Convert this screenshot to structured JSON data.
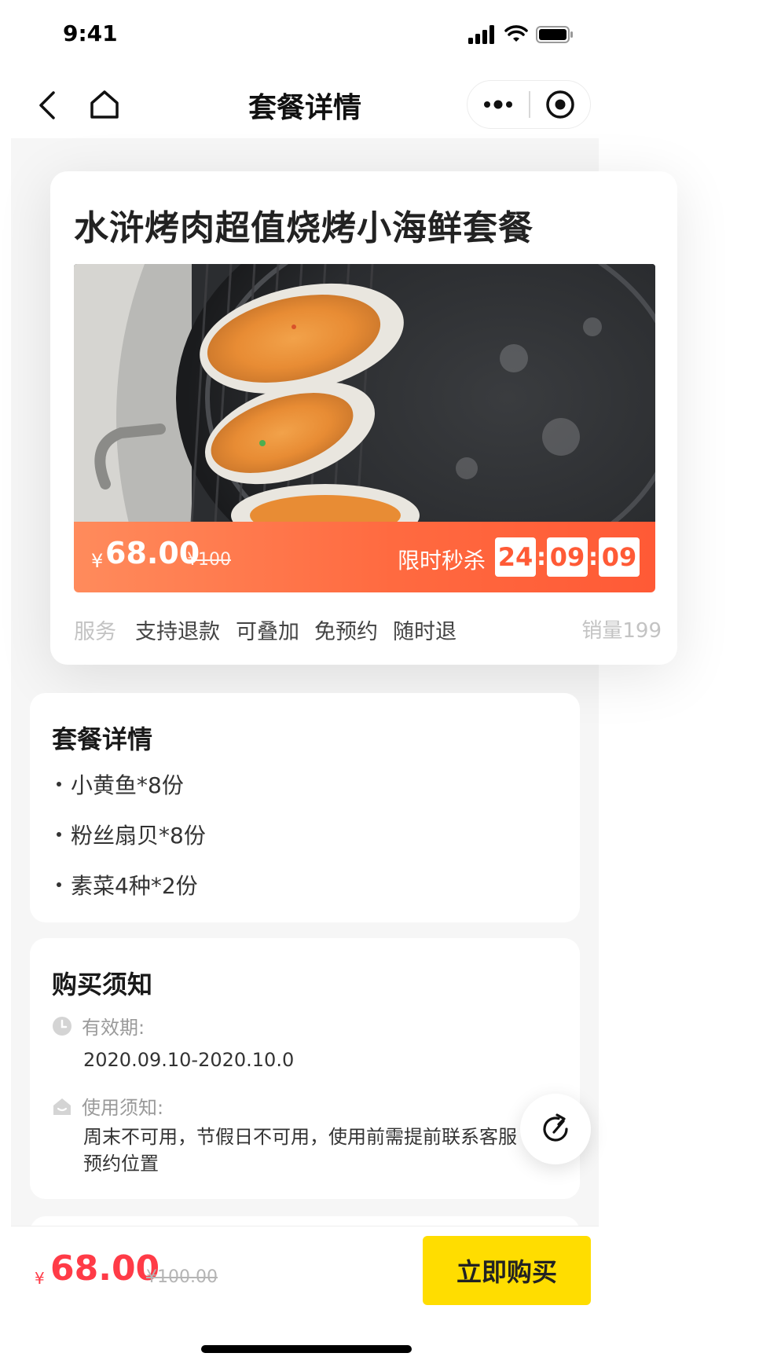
{
  "status_bar": {
    "time": "9:41"
  },
  "nav": {
    "title": "套餐详情"
  },
  "deal": {
    "title": "水浒烤肉超值烧烤小海鲜套餐",
    "currency": "¥",
    "price": "68.00",
    "original_price": "¥100",
    "flash_label": "限时秒杀",
    "countdown": {
      "hours": "24",
      "minutes": "09",
      "seconds": "09"
    },
    "service_label": "服务",
    "service_tags": [
      "支持退款",
      "可叠加",
      "免预约",
      "随时退"
    ],
    "sales": "销量199"
  },
  "package": {
    "title": "套餐详情",
    "items": [
      "小黄鱼*8份",
      "粉丝扇贝*8份",
      "素菜4种*2份"
    ]
  },
  "notice": {
    "title": "购买须知",
    "validity_label": "有效期:",
    "validity_value": "2020.09.10-2020.10.0",
    "usage_label": "使用须知:",
    "usage_value": "周末不可用，节假日不可用，使用前需提前联系客服预约位置"
  },
  "bottom_bar": {
    "currency": "¥",
    "price": "68.00",
    "original_price": "¥100.00",
    "buy_label": "立即购买"
  },
  "icons": {
    "back": "chevron-left-icon",
    "home": "home-icon",
    "more": "more-dots-icon",
    "close": "target-circle-icon",
    "clock": "clock-icon",
    "house": "house-icon",
    "share": "share-arrow-icon"
  },
  "colors": {
    "accent_orange": "#ff6a40",
    "price_red": "#ff3b47",
    "buy_yellow": "#ffdd00"
  }
}
